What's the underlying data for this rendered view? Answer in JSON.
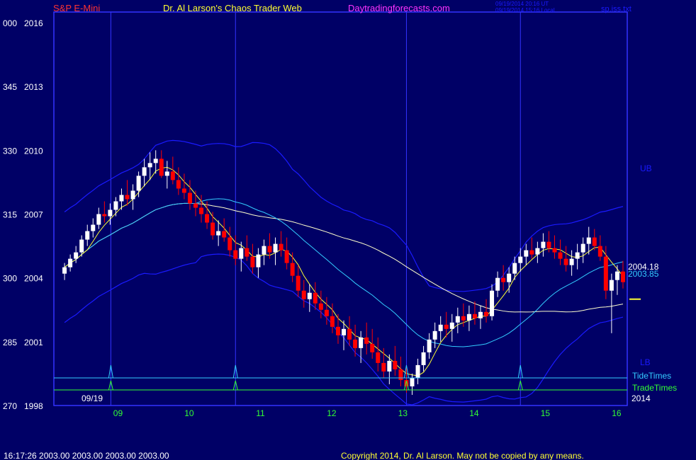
{
  "header": {
    "symbol": "S&P E-Mini",
    "title": "Dr. Al Larson's Chaos Trader Web",
    "site": "Daytradingforecasts.com",
    "stamp_ut": "09/19/2014 20:16 UT",
    "stamp_local": "09/19/2014 15:16 Local",
    "file": "sp.iss.txt"
  },
  "footer": {
    "status": "16:17:26  2003.00 2003.00 2003.00 2003.00",
    "copyright": "Copyright 2014, Dr. Al Larson. May not be copied by any means."
  },
  "colors": {
    "background": "#000066",
    "frame": "#3333ff",
    "axis_text": "#ffffff",
    "x_tick_text": "#33ff33",
    "symbol_text": "#ff3333",
    "site_text": "#ff33ff",
    "up_bar": "#ffffff",
    "down_bar": "#ff0000",
    "ma_fast": "#ffff33",
    "ma_mid": "#33ccff",
    "ma_slow": "#ffffcc",
    "band": "#1a1aff",
    "tide": "#33ccff",
    "trade": "#33ff33"
  },
  "chart_data": {
    "type": "candlestick",
    "ylim": [
      1998,
      2016.5
    ],
    "y_ticks": [
      {
        "value": 2016,
        "left": "000",
        "right": "2016"
      },
      {
        "value": 2013,
        "left": "345",
        "right": "2013"
      },
      {
        "value": 2010,
        "left": "330",
        "right": "2010"
      },
      {
        "value": 2007,
        "left": "315",
        "right": "2007"
      },
      {
        "value": 2004,
        "left": "300",
        "right": "2004"
      },
      {
        "value": 2001,
        "left": "285",
        "right": "2001"
      },
      {
        "value": 1998,
        "left": "270",
        "right": "1998"
      }
    ],
    "x_ticks": [
      "09",
      "10",
      "11",
      "12",
      "13",
      "14",
      "15",
      "16"
    ],
    "start_label": "09/19",
    "end_label": "2014",
    "band_labels": {
      "upper": "UB",
      "lower": "LB"
    },
    "legend": {
      "tide": "TideTimes",
      "trade": "TradeTimes"
    },
    "last_price_labels": [
      "2004.18",
      "2003.85"
    ],
    "last_price_line": 2003.0,
    "event_time_hours": [
      8.9,
      10.65,
      13.05,
      14.65
    ],
    "bars": [
      [
        8.25,
        2004.2,
        2004.7,
        2003.9,
        2004.5
      ],
      [
        8.33,
        2004.5,
        2005.1,
        2004.3,
        2004.9
      ],
      [
        8.41,
        2004.9,
        2005.5,
        2004.7,
        2005.2
      ],
      [
        8.49,
        2005.2,
        2006.0,
        2005.0,
        2005.8
      ],
      [
        8.57,
        2005.8,
        2006.5,
        2005.5,
        2006.2
      ],
      [
        8.65,
        2006.2,
        2006.8,
        2005.9,
        2006.5
      ],
      [
        8.73,
        2006.5,
        2007.3,
        2006.3,
        2007.0
      ],
      [
        8.81,
        2007.0,
        2007.6,
        2006.6,
        2006.9
      ],
      [
        8.89,
        2006.9,
        2007.5,
        2006.5,
        2007.2
      ],
      [
        8.97,
        2007.2,
        2007.8,
        2006.9,
        2007.6
      ],
      [
        9.05,
        2007.6,
        2008.2,
        2007.2,
        2007.9
      ],
      [
        9.13,
        2007.9,
        2008.6,
        2007.4,
        2007.7
      ],
      [
        9.21,
        2007.7,
        2008.4,
        2007.2,
        2008.1
      ],
      [
        9.29,
        2008.1,
        2009.0,
        2007.8,
        2008.8
      ],
      [
        9.37,
        2008.8,
        2009.6,
        2008.3,
        2009.2
      ],
      [
        9.45,
        2009.2,
        2009.9,
        2008.6,
        2009.4
      ],
      [
        9.53,
        2009.4,
        2010.0,
        2008.9,
        2009.6
      ],
      [
        9.61,
        2009.6,
        2010.0,
        2008.7,
        2008.8
      ],
      [
        9.69,
        2008.8,
        2009.5,
        2008.2,
        2009.0
      ],
      [
        9.77,
        2009.0,
        2009.7,
        2008.4,
        2008.6
      ],
      [
        9.85,
        2008.6,
        2009.2,
        2007.9,
        2008.2
      ],
      [
        9.93,
        2008.2,
        2008.9,
        2007.7,
        2008.0
      ],
      [
        10.01,
        2008.0,
        2008.6,
        2007.2,
        2007.5
      ],
      [
        10.09,
        2007.5,
        2008.1,
        2006.9,
        2007.3
      ],
      [
        10.17,
        2007.3,
        2007.9,
        2006.6,
        2007.0
      ],
      [
        10.25,
        2007.0,
        2007.6,
        2006.3,
        2006.6
      ],
      [
        10.33,
        2006.6,
        2007.1,
        2005.8,
        2006.0
      ],
      [
        10.41,
        2006.0,
        2006.7,
        2005.5,
        2006.2
      ],
      [
        10.49,
        2006.2,
        2006.8,
        2005.7,
        2005.9
      ],
      [
        10.57,
        2005.9,
        2006.4,
        2005.0,
        2005.3
      ],
      [
        10.65,
        2005.3,
        2006.0,
        2004.6,
        2004.9
      ],
      [
        10.73,
        2004.9,
        2005.7,
        2004.3,
        2005.4
      ],
      [
        10.81,
        2005.4,
        2006.0,
        2004.8,
        2005.0
      ],
      [
        10.89,
        2005.0,
        2005.6,
        2004.2,
        2004.5
      ],
      [
        10.97,
        2004.5,
        2005.4,
        2004.0,
        2005.1
      ],
      [
        11.05,
        2005.1,
        2005.8,
        2004.6,
        2005.5
      ],
      [
        11.13,
        2005.5,
        2006.1,
        2004.9,
        2005.2
      ],
      [
        11.21,
        2005.2,
        2005.9,
        2004.6,
        2005.6
      ],
      [
        11.29,
        2005.6,
        2006.2,
        2005.0,
        2005.3
      ],
      [
        11.37,
        2005.3,
        2005.9,
        2004.4,
        2004.7
      ],
      [
        11.45,
        2004.7,
        2005.2,
        2003.8,
        2004.1
      ],
      [
        11.53,
        2004.1,
        2004.6,
        2003.1,
        2003.4
      ],
      [
        11.61,
        2003.4,
        2003.9,
        2002.6,
        2003.0
      ],
      [
        11.69,
        2003.0,
        2003.7,
        2002.4,
        2003.3
      ],
      [
        11.77,
        2003.3,
        2003.8,
        2002.5,
        2002.8
      ],
      [
        11.85,
        2002.8,
        2003.4,
        2002.1,
        2002.5
      ],
      [
        11.93,
        2002.5,
        2003.1,
        2001.8,
        2002.2
      ],
      [
        12.01,
        2002.2,
        2002.8,
        2001.4,
        2001.7
      ],
      [
        12.09,
        2001.7,
        2002.3,
        2000.9,
        2001.3
      ],
      [
        12.17,
        2001.3,
        2002.0,
        2000.6,
        2001.6
      ],
      [
        12.25,
        2001.6,
        2002.2,
        2000.8,
        2001.1
      ],
      [
        12.33,
        2001.1,
        2001.8,
        2000.3,
        2000.7
      ],
      [
        12.41,
        2000.7,
        2001.5,
        2000.0,
        2001.2
      ],
      [
        12.49,
        2001.2,
        2001.9,
        2000.4,
        2000.9
      ],
      [
        12.57,
        2000.9,
        2001.6,
        2000.2,
        2000.5
      ],
      [
        12.65,
        2000.5,
        2001.2,
        1999.6,
        2000.0
      ],
      [
        12.73,
        2000.0,
        2000.7,
        1999.3,
        1999.6
      ],
      [
        12.81,
        1999.6,
        2000.4,
        1999.0,
        2000.1
      ],
      [
        12.89,
        2000.1,
        2000.8,
        1999.4,
        1999.7
      ],
      [
        12.97,
        1999.7,
        2000.3,
        1998.9,
        1999.2
      ],
      [
        13.05,
        1999.2,
        1999.8,
        1998.6,
        1998.9
      ],
      [
        13.13,
        1998.9,
        1999.5,
        1998.5,
        1999.3
      ],
      [
        13.21,
        1999.3,
        2000.2,
        1999.0,
        1999.9
      ],
      [
        13.29,
        1999.9,
        2000.8,
        1999.6,
        2000.5
      ],
      [
        13.37,
        2000.5,
        2001.4,
        2000.2,
        2001.1
      ],
      [
        13.45,
        2001.1,
        2001.9,
        2000.7,
        2001.5
      ],
      [
        13.53,
        2001.5,
        2002.2,
        2001.0,
        2001.8
      ],
      [
        13.61,
        2001.8,
        2002.4,
        2001.2,
        2001.6
      ],
      [
        13.69,
        2001.6,
        2002.3,
        2001.0,
        2001.9
      ],
      [
        13.77,
        2001.9,
        2002.6,
        2001.4,
        2002.2
      ],
      [
        13.85,
        2002.2,
        2002.8,
        2001.7,
        2002.0
      ],
      [
        13.93,
        2002.0,
        2002.7,
        2001.5,
        2002.3
      ],
      [
        14.01,
        2002.3,
        2002.9,
        2001.8,
        2002.1
      ],
      [
        14.09,
        2002.1,
        2002.7,
        2001.6,
        2002.4
      ],
      [
        14.17,
        2002.4,
        2003.0,
        2001.9,
        2002.2
      ],
      [
        14.25,
        2002.2,
        2003.7,
        2002.0,
        2003.4
      ],
      [
        14.33,
        2003.4,
        2004.3,
        2003.1,
        2004.0
      ],
      [
        14.41,
        2004.0,
        2004.6,
        2003.4,
        2003.8
      ],
      [
        14.49,
        2003.8,
        2004.5,
        2003.3,
        2004.2
      ],
      [
        14.57,
        2004.2,
        2005.0,
        2003.9,
        2004.7
      ],
      [
        14.65,
        2004.7,
        2005.4,
        2004.3,
        2005.0
      ],
      [
        14.73,
        2005.0,
        2005.6,
        2004.6,
        2005.3
      ],
      [
        14.81,
        2005.3,
        2005.9,
        2004.9,
        2005.1
      ],
      [
        14.89,
        2005.1,
        2005.7,
        2004.7,
        2005.4
      ],
      [
        14.97,
        2005.4,
        2006.1,
        2005.0,
        2005.7
      ],
      [
        15.05,
        2005.7,
        2006.2,
        2005.2,
        2005.4
      ],
      [
        15.13,
        2005.4,
        2006.0,
        2004.9,
        2005.2
      ],
      [
        15.21,
        2005.2,
        2005.8,
        2004.6,
        2004.9
      ],
      [
        15.29,
        2004.9,
        2005.5,
        2004.3,
        2004.6
      ],
      [
        15.37,
        2004.6,
        2005.3,
        2004.1,
        2004.9
      ],
      [
        15.45,
        2004.9,
        2005.6,
        2004.4,
        2005.2
      ],
      [
        15.53,
        2005.2,
        2005.9,
        2004.7,
        2005.6
      ],
      [
        15.61,
        2005.6,
        2006.4,
        2005.1,
        2005.9
      ],
      [
        15.69,
        2005.9,
        2006.3,
        2005.3,
        2005.5
      ],
      [
        15.77,
        2005.5,
        2006.0,
        2004.8,
        2005.0
      ],
      [
        15.85,
        2005.0,
        2005.5,
        2003.0,
        2003.4
      ],
      [
        15.93,
        2003.4,
        2004.2,
        2001.4,
        2003.9
      ],
      [
        16.01,
        2003.9,
        2004.6,
        2003.2,
        2004.3
      ],
      [
        16.09,
        2004.3,
        2004.8,
        2003.5,
        2003.8
      ]
    ]
  }
}
